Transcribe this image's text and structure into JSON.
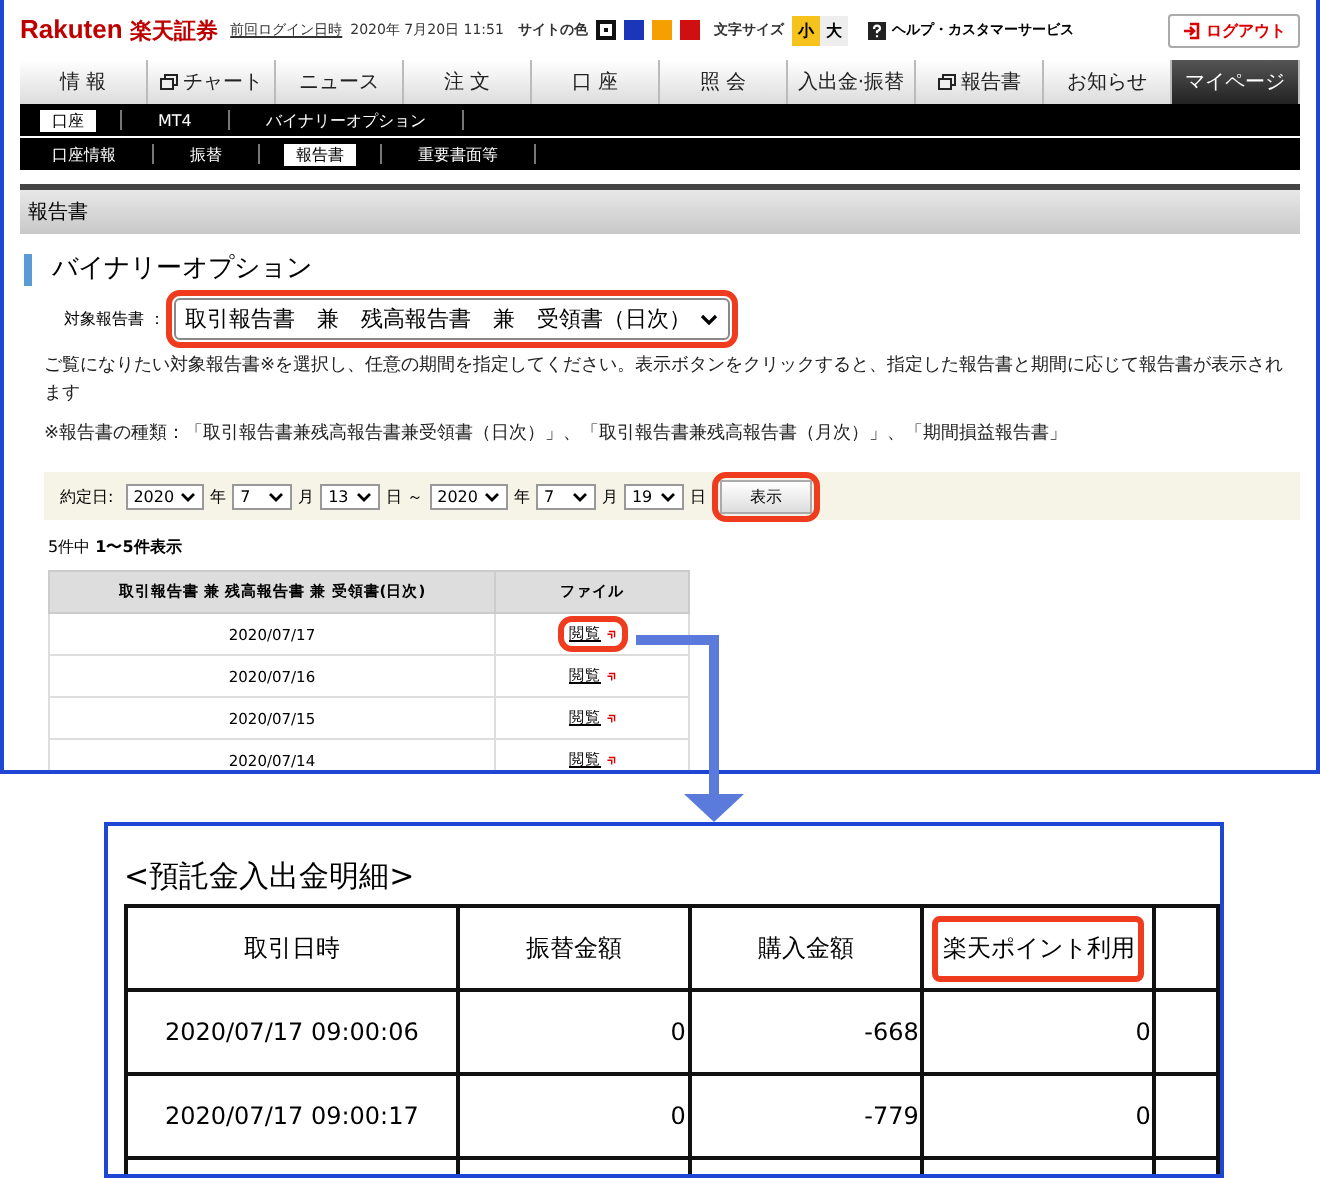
{
  "header": {
    "logo_latin": "Rakuten",
    "logo_kanji": "楽天証券",
    "last_login_label": "前回ログイン日時",
    "last_login": "2020年 7月20日 11:51",
    "site_color_label": "サイトの色",
    "site_colors": [
      {
        "color": "#111111",
        "selected": true
      },
      {
        "color": "#1b36b8",
        "selected": false
      },
      {
        "color": "#f5a000",
        "selected": false
      },
      {
        "color": "#d01010",
        "selected": false
      }
    ],
    "font_size_label": "文字サイズ",
    "font_sizes": [
      {
        "label": "小",
        "selected": true
      },
      {
        "label": "大",
        "selected": false
      }
    ],
    "help": "ヘルプ・カスタマーサービス",
    "logout": "ログアウト"
  },
  "nav_tabs": [
    {
      "label": "情 報",
      "kind": "plain",
      "selected": false
    },
    {
      "label": "チャート",
      "kind": "window",
      "selected": false
    },
    {
      "label": "ニュース",
      "kind": "plain",
      "selected": false
    },
    {
      "label": "注 文",
      "kind": "plain",
      "selected": false
    },
    {
      "label": "口 座",
      "kind": "plain",
      "selected": false
    },
    {
      "label": "照 会",
      "kind": "plain",
      "selected": false
    },
    {
      "label": "入出金·振替",
      "kind": "plain",
      "selected": false
    },
    {
      "label": "報告書",
      "kind": "window",
      "selected": false
    },
    {
      "label": "お知らせ",
      "kind": "plain",
      "selected": false
    },
    {
      "label": "マイページ",
      "kind": "plain",
      "selected": true
    }
  ],
  "subnav_1": [
    {
      "label": "口座",
      "selected": true
    },
    {
      "label": "MT4",
      "selected": false
    },
    {
      "label": "バイナリーオプション",
      "selected": false
    }
  ],
  "subnav_2": [
    {
      "label": "口座情報",
      "selected": false
    },
    {
      "label": "振替",
      "selected": false
    },
    {
      "label": "報告書",
      "selected": true
    },
    {
      "label": "重要書面等",
      "selected": false
    }
  ],
  "section_header": "報告書",
  "page_title": "バイナリーオプション",
  "report_select": {
    "label": "対象報告書 ：",
    "value": "取引報告書　兼　残高報告書　兼　受領書（日次）",
    "highlighted": true
  },
  "description": "ご覧になりたい対象報告書※を選択し、任意の期間を指定してください。表示ボタンをクリックすると、指定した報告書と期間に応じて報告書が表示されます",
  "note": "※報告書の種類：「取引報告書兼残高報告書兼受領書（日次）」、「取引報告書兼残高報告書（月次）」、「期間損益報告書」",
  "date_filter": {
    "label": "約定日:",
    "items": [
      {
        "kind": "select",
        "value": "2020"
      },
      {
        "kind": "text",
        "value": "年"
      },
      {
        "kind": "select",
        "value": "7"
      },
      {
        "kind": "text",
        "value": "月"
      },
      {
        "kind": "select",
        "value": "13"
      },
      {
        "kind": "text",
        "value": "日 ～"
      },
      {
        "kind": "select",
        "value": "2020"
      },
      {
        "kind": "text",
        "value": "年"
      },
      {
        "kind": "select",
        "value": "7"
      },
      {
        "kind": "text",
        "value": "月"
      },
      {
        "kind": "select",
        "value": "19"
      },
      {
        "kind": "text",
        "value": "日"
      }
    ],
    "button": "表示",
    "button_highlighted": true
  },
  "result_count": "5件中 **1〜5件表示**",
  "report_table": {
    "columns": [
      "取引報告書 兼 残高報告書 兼 受領書(日次)",
      "ファイル"
    ],
    "rows": [
      {
        "date": "2020/07/17",
        "link": "閲覧",
        "highlighted": true
      },
      {
        "date": "2020/07/16",
        "link": "閲覧",
        "highlighted": false
      },
      {
        "date": "2020/07/15",
        "link": "閲覧",
        "highlighted": false
      },
      {
        "date": "2020/07/14",
        "link": "閲覧",
        "highlighted": false
      }
    ]
  },
  "detail": {
    "title": "<預託金入出金明細>",
    "columns": [
      {
        "label": "取引日時",
        "highlighted": false
      },
      {
        "label": "振替金額",
        "highlighted": false
      },
      {
        "label": "購入金額",
        "highlighted": false
      },
      {
        "label": "楽天ポイント利用",
        "highlighted": true
      }
    ],
    "rows": [
      [
        "2020/07/17 09:00:06",
        "0",
        "-668",
        "0"
      ],
      [
        "2020/07/17 09:00:17",
        "0",
        "-779",
        "0"
      ]
    ]
  }
}
